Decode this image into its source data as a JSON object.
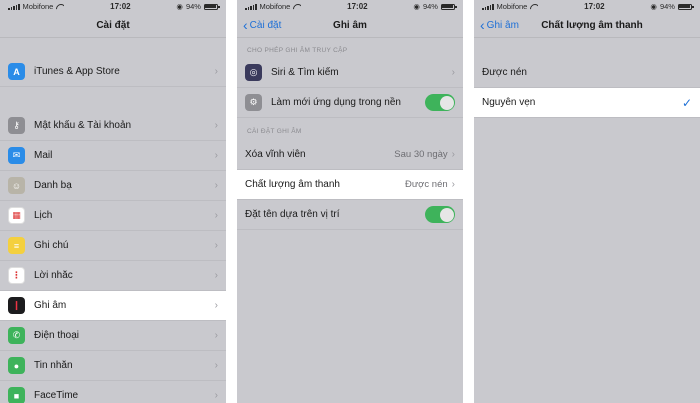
{
  "status_bar": {
    "carrier": "Mobifone",
    "time": "17:02",
    "battery": "94%",
    "battery_level": 0.94
  },
  "screen1": {
    "title": "Cài đặt",
    "items": [
      {
        "label": "iTunes & App Store",
        "icon": "app-store-icon",
        "color": "#2a8ce8"
      },
      {
        "label": "Mật khẩu & Tài khoản",
        "icon": "key-icon",
        "color": "#8e8e93"
      },
      {
        "label": "Mail",
        "icon": "mail-icon",
        "color": "#2a8ce8"
      },
      {
        "label": "Danh bạ",
        "icon": "contacts-icon",
        "color": "#b8b4a8"
      },
      {
        "label": "Lịch",
        "icon": "calendar-icon",
        "color": "#ffffff"
      },
      {
        "label": "Ghi chú",
        "icon": "notes-icon",
        "color": "#f4d03f"
      },
      {
        "label": "Lời nhắc",
        "icon": "reminders-icon",
        "color": "#ffffff"
      },
      {
        "label": "Ghi âm",
        "icon": "voice-memos-icon",
        "color": "#1c1c1e"
      },
      {
        "label": "Điện thoại",
        "icon": "phone-icon",
        "color": "#3eb35b"
      },
      {
        "label": "Tin nhắn",
        "icon": "messages-icon",
        "color": "#3eb35b"
      },
      {
        "label": "FaceTime",
        "icon": "facetime-icon",
        "color": "#3eb35b"
      }
    ]
  },
  "screen2": {
    "back_label": "Cài đặt",
    "title": "Ghi âm",
    "section1_header": "CHO PHÉP GHI ÂM TRUY CẬP",
    "siri_label": "Siri & Tìm kiếm",
    "refresh_label": "Làm mới ứng dụng trong nền",
    "section2_header": "CÀI ĐẶT GHI ÂM",
    "delete_label": "Xóa vĩnh viễn",
    "delete_value": "Sau 30 ngày",
    "quality_label": "Chất lượng âm thanh",
    "quality_value": "Được nén",
    "location_label": "Đặt tên dựa trên vị trí"
  },
  "screen3": {
    "back_label": "Ghi âm",
    "title": "Chất lượng âm thanh",
    "options": [
      {
        "label": "Được nén",
        "selected": false
      },
      {
        "label": "Nguyên vẹn",
        "selected": true
      }
    ]
  },
  "colors": {
    "accent": "#1d6fd6",
    "toggle_on": "#3eb35b",
    "dim_background": "#c9c9ce"
  }
}
